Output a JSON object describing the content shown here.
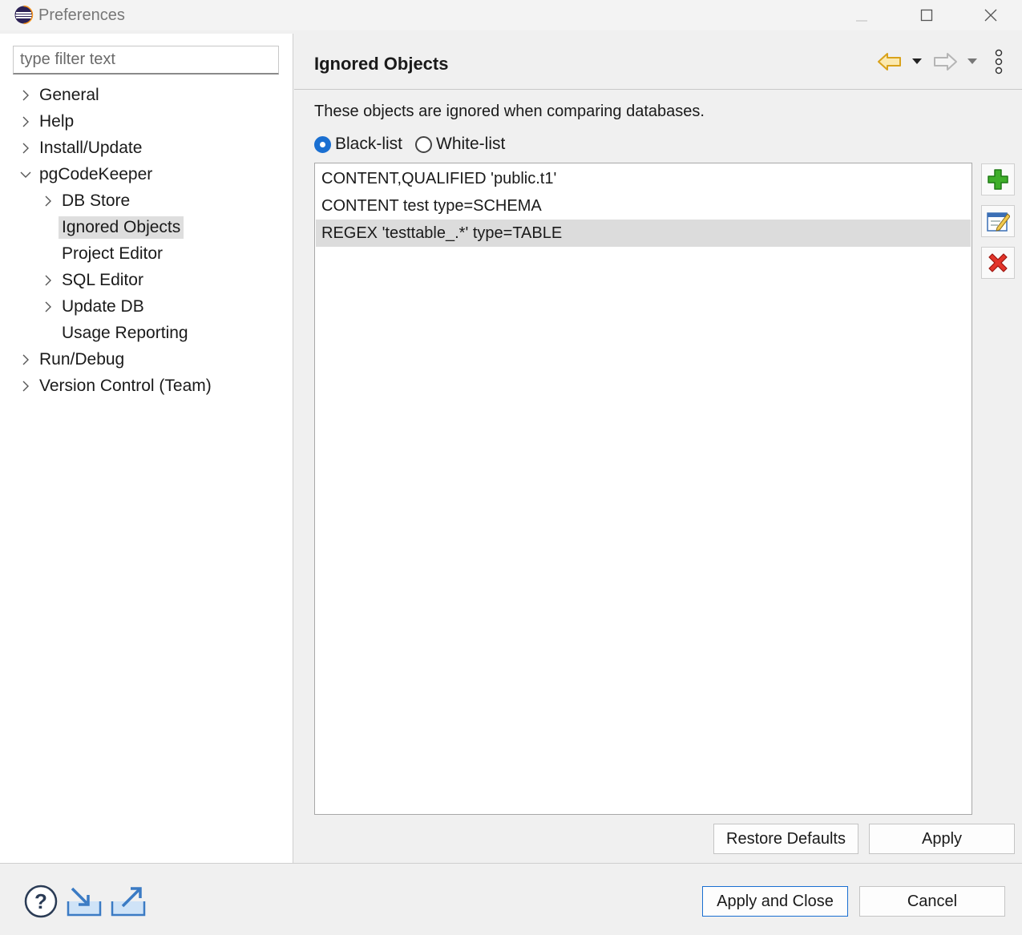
{
  "window": {
    "title": "Preferences",
    "icons": [
      "eclipse-logo-icon",
      "minimize-icon",
      "maximize-icon",
      "close-icon"
    ]
  },
  "sidebar": {
    "filter_placeholder": "type filter text",
    "filter_value": "",
    "tree": [
      {
        "label": "General",
        "level": 0,
        "expander": "collapsed"
      },
      {
        "label": "Help",
        "level": 0,
        "expander": "collapsed"
      },
      {
        "label": "Install/Update",
        "level": 0,
        "expander": "collapsed"
      },
      {
        "label": "pgCodeKeeper",
        "level": 0,
        "expander": "expanded"
      },
      {
        "label": "DB Store",
        "level": 1,
        "expander": "collapsed"
      },
      {
        "label": "Ignored Objects",
        "level": 1,
        "expander": "none",
        "selected": true
      },
      {
        "label": "Project Editor",
        "level": 1,
        "expander": "none"
      },
      {
        "label": "SQL Editor",
        "level": 1,
        "expander": "collapsed"
      },
      {
        "label": "Update DB",
        "level": 1,
        "expander": "collapsed"
      },
      {
        "label": "Usage Reporting",
        "level": 1,
        "expander": "none"
      },
      {
        "label": "Run/Debug",
        "level": 0,
        "expander": "collapsed"
      },
      {
        "label": "Version Control (Team)",
        "level": 0,
        "expander": "collapsed"
      }
    ]
  },
  "page": {
    "title": "Ignored Objects",
    "description": "These objects are ignored when comparing databases.",
    "nav_icons": [
      "back-arrow-icon",
      "back-dropdown-icon",
      "forward-arrow-icon",
      "forward-dropdown-icon",
      "more-menu-icon"
    ],
    "list_mode": {
      "options": [
        {
          "label": "Black-list",
          "checked": true
        },
        {
          "label": "White-list",
          "checked": false
        }
      ]
    },
    "rules": [
      {
        "text": "CONTENT,QUALIFIED 'public.t1'",
        "selected": false
      },
      {
        "text": "CONTENT test type=SCHEMA",
        "selected": false
      },
      {
        "text": "REGEX 'testtable_.*' type=TABLE",
        "selected": true
      }
    ],
    "side_buttons": [
      "add-icon",
      "edit-icon",
      "delete-icon"
    ],
    "restore_defaults_label": "Restore Defaults",
    "apply_label": "Apply"
  },
  "footer": {
    "icons": [
      "help-icon",
      "import-icon",
      "export-icon"
    ],
    "apply_close_label": "Apply and Close",
    "cancel_label": "Cancel"
  },
  "colors": {
    "accent": "#1a6fd1",
    "selection": "#dcdcdc",
    "add_green": "#3fae2a",
    "delete_red": "#d9261c",
    "back_arrow": "#d9a21b"
  }
}
